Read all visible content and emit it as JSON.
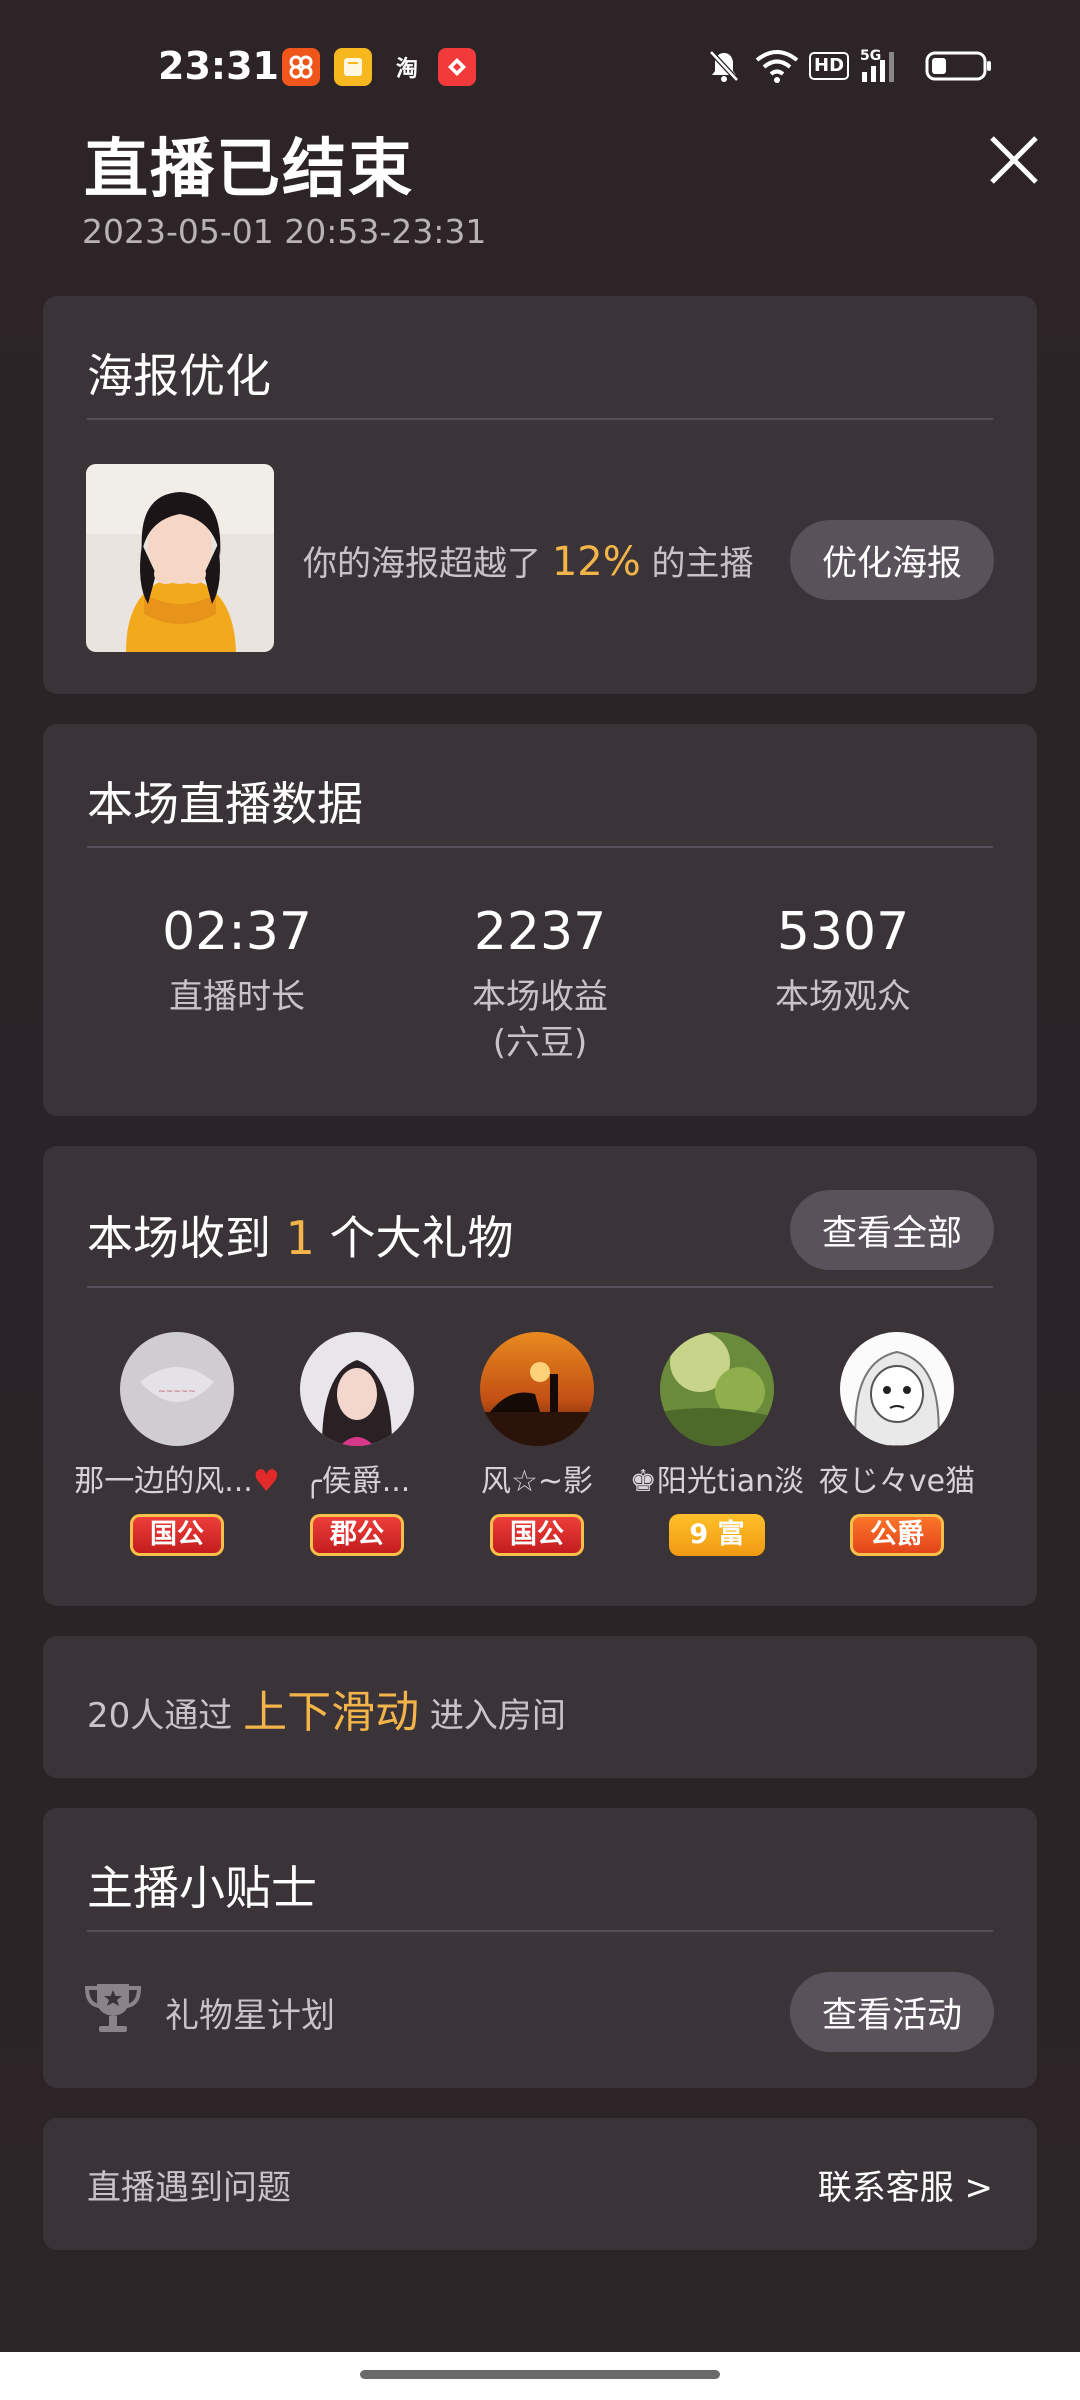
{
  "status_bar": {
    "time": "23:31",
    "apps": [
      "app-icon-orange",
      "app-icon-yellow",
      "taobao-icon",
      "app-icon-red"
    ],
    "taobao_text": "淘",
    "hd_label": "HD",
    "network_label": "5G"
  },
  "header": {
    "title": "直播已结束",
    "time_range": "2023-05-01 20:53-23:31"
  },
  "poster": {
    "title": "海报优化",
    "text_prefix": "你的海报超越了",
    "percent": "12%",
    "text_suffix": "的主播",
    "button": "优化海报"
  },
  "stats": {
    "title": "本场直播数据",
    "items": [
      {
        "value": "02:37",
        "label": "直播时长",
        "sub": ""
      },
      {
        "value": "2237",
        "label": "本场收益",
        "sub": "(六豆)"
      },
      {
        "value": "5307",
        "label": "本场观众",
        "sub": ""
      }
    ]
  },
  "gifts": {
    "title_prefix": "本场收到",
    "count": "1",
    "title_suffix": "个大礼物",
    "button": "查看全部",
    "users": [
      {
        "name": "那一边的风...",
        "badge": "国公",
        "badge_color": "#d8232a"
      },
      {
        "name": "╭侯爵...",
        "badge": "郡公",
        "badge_color": "#d8232a"
      },
      {
        "name": "风☆~影",
        "badge": "国公",
        "badge_color": "#d8232a"
      },
      {
        "name": "♚阳光tian淡",
        "badge": "9 富",
        "badge_color": "#f5a623"
      },
      {
        "name": "夜じ々ve猫",
        "badge": "公爵",
        "badge_color": "#ec5a1e"
      }
    ]
  },
  "swipe": {
    "prefix": "20人通过",
    "highlight": "上下滑动",
    "suffix": "进入房间"
  },
  "tips": {
    "title": "主播小贴士",
    "item": "礼物星计划",
    "button": "查看活动"
  },
  "help": {
    "text": "直播遇到问题",
    "link": "联系客服 >"
  },
  "colors": {
    "accent": "#f3b54a",
    "card": "#3a3338",
    "pill": "#5a525a"
  }
}
